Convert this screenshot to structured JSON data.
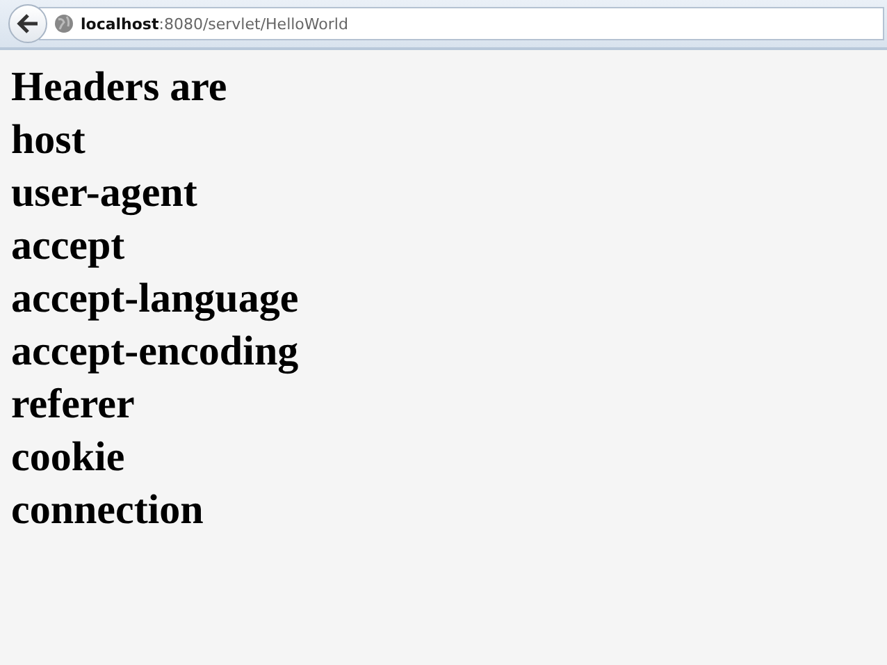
{
  "address_bar": {
    "url": "**localhost**:8080/servlet/HelloWorld"
  },
  "page": {
    "heading": "Headers are",
    "lines": [
      "host",
      "user-agent",
      "accept",
      "accept-language",
      "accept-encoding",
      "referer",
      "cookie",
      "connection"
    ]
  }
}
